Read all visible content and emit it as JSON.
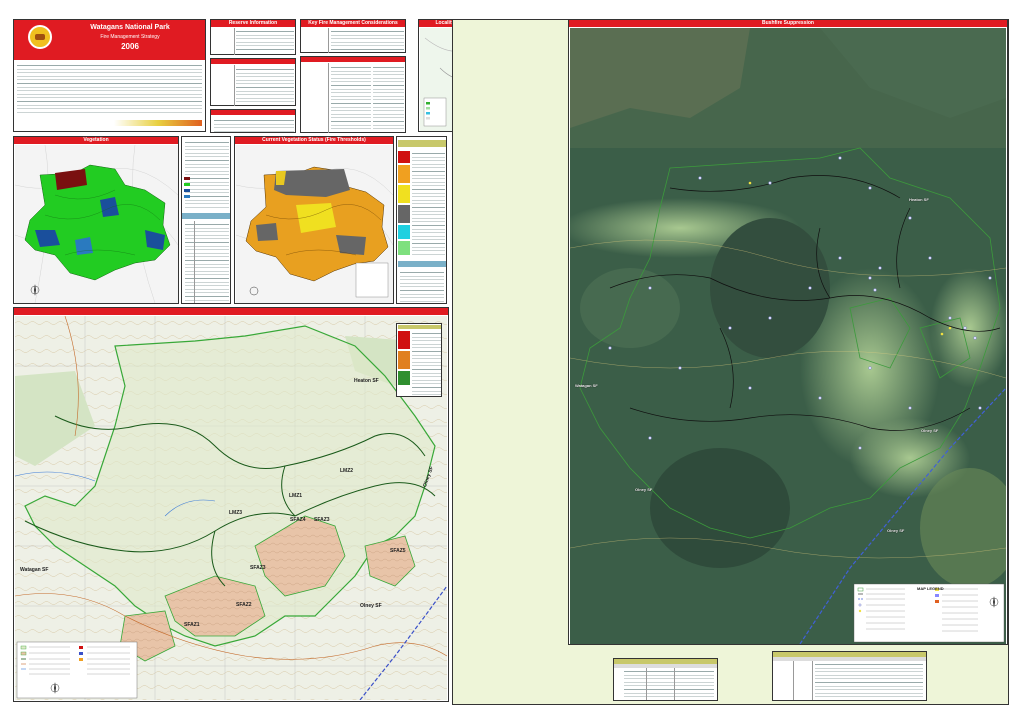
{
  "title_block": {
    "park_name": "Watagans National Park",
    "subtitle": "Fire Management Strategy",
    "year": "2006"
  },
  "sections": {
    "reserve_information": "Reserve Information",
    "key_fire_management": "Key Fire Management Considerations",
    "location": "Locality of Area and Local Government Areas",
    "suppression": "Bushfire Suppression",
    "vegetation": "Vegetation",
    "vegetation_status": "Current Vegetation Status (Fire Thresholds)"
  },
  "map_labels": {
    "topo": [
      "Heaton SF",
      "LMZ2",
      "LMZ1",
      "LMZ3",
      "SFAZ4",
      "SFAZ3",
      "SFAZ5",
      "SFAZ3",
      "SFAZ2",
      "SFAZ1",
      "Watagan SF",
      "Olney SF",
      "Olney SF"
    ],
    "sat": [
      "Heaton SF",
      "Watagan SF",
      "Olney SF",
      "Olney SF",
      "Olney SF"
    ]
  },
  "legend": {
    "title": "MAP LEGEND"
  },
  "colors": {
    "header_red": "#e01b22",
    "panel_olive": "#c8c86a",
    "veg_green": "#22cc22",
    "veg_dark": "#1a4f9c",
    "status_grey": "#666666",
    "status_orange": "#e8a020",
    "status_yellow": "#f0e020",
    "zone_green": "#2f8f2f",
    "zone_red": "#d01010"
  }
}
